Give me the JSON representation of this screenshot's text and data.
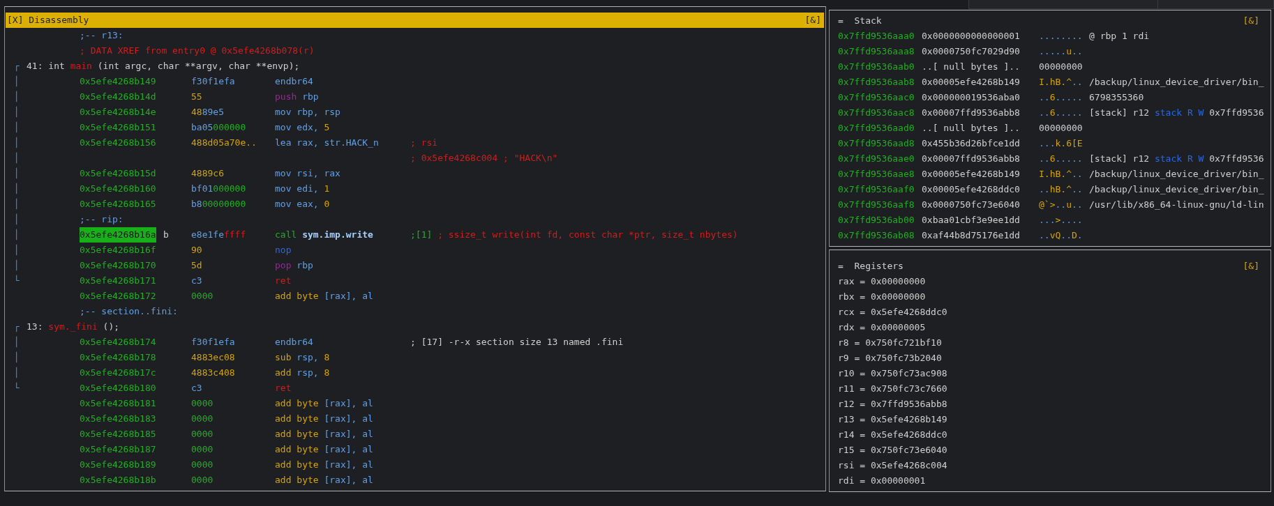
{
  "disassembly": {
    "title": "[X] Disassembly",
    "badge": "[&]",
    "lines": [
      {
        "kind": "label",
        "text": ";-- r13:"
      },
      {
        "kind": "xref",
        "text": "; DATA XREF from entry0 @ 0x5efe4268b078(r)"
      },
      {
        "kind": "func",
        "tree": "┌",
        "segments": [
          {
            "kind": "plain",
            "text": "41: int "
          },
          {
            "kind": "red",
            "text": "main"
          },
          {
            "kind": "plain",
            "text": " (int argc, char **argv, char **envp);"
          }
        ]
      },
      {
        "kind": "instr",
        "tree": "│",
        "address": "0x5efe4268b149",
        "current": false,
        "bytes": [
          {
            "kind": "hex",
            "text": "f30f1efa"
          }
        ],
        "instr": [
          {
            "kind": "op",
            "text": "endbr64"
          }
        ]
      },
      {
        "kind": "instr",
        "tree": "│",
        "address": "0x5efe4268b14d",
        "current": false,
        "bytes": [
          {
            "kind": "num",
            "text": "55"
          }
        ],
        "instr": [
          {
            "kind": "push",
            "text": "push"
          },
          {
            "kind": "op",
            "text": " rbp"
          }
        ]
      },
      {
        "kind": "instr",
        "tree": "│",
        "address": "0x5efe4268b14e",
        "current": false,
        "bytes": [
          {
            "kind": "num",
            "text": "48"
          },
          {
            "kind": "hex",
            "text": "89e5"
          }
        ],
        "instr": [
          {
            "kind": "op",
            "text": "mov rbp, rsp"
          }
        ]
      },
      {
        "kind": "instr",
        "tree": "│",
        "address": "0x5efe4268b151",
        "current": false,
        "bytes": [
          {
            "kind": "hex",
            "text": "ba05"
          },
          {
            "kind": "zero",
            "text": "000000"
          }
        ],
        "instr": [
          {
            "kind": "op",
            "text": "mov edx, "
          },
          {
            "kind": "num",
            "text": "5"
          }
        ]
      },
      {
        "kind": "instr",
        "tree": "│",
        "address": "0x5efe4268b156",
        "current": false,
        "bytes": [
          {
            "kind": "num",
            "text": "488d05a70e.."
          }
        ],
        "instr": [
          {
            "kind": "op",
            "text": "lea rax, str.HACK_n"
          }
        ],
        "comment": [
          {
            "kind": "red",
            "text": "; rsi"
          }
        ]
      },
      {
        "kind": "comment",
        "tree": "│",
        "comment": [
          {
            "kind": "red",
            "text": "; 0x5efe4268c004 ; \"HACK\\n\""
          }
        ]
      },
      {
        "kind": "instr",
        "tree": "│",
        "address": "0x5efe4268b15d",
        "current": false,
        "bytes": [
          {
            "kind": "num",
            "text": "4889c6"
          }
        ],
        "instr": [
          {
            "kind": "op",
            "text": "mov rsi, rax"
          }
        ]
      },
      {
        "kind": "instr",
        "tree": "│",
        "address": "0x5efe4268b160",
        "current": false,
        "bytes": [
          {
            "kind": "hex",
            "text": "bf01"
          },
          {
            "kind": "zero",
            "text": "000000"
          }
        ],
        "instr": [
          {
            "kind": "op",
            "text": "mov edi, "
          },
          {
            "kind": "num",
            "text": "1"
          }
        ]
      },
      {
        "kind": "instr",
        "tree": "│",
        "address": "0x5efe4268b165",
        "current": false,
        "bytes": [
          {
            "kind": "hex",
            "text": "b8"
          },
          {
            "kind": "zero",
            "text": "00000000"
          }
        ],
        "instr": [
          {
            "kind": "op",
            "text": "mov eax, "
          },
          {
            "kind": "num",
            "text": "0"
          }
        ]
      },
      {
        "kind": "label",
        "tree": "│",
        "text": ";-- rip:"
      },
      {
        "kind": "instr",
        "tree": "│",
        "address": "0x5efe4268b16a",
        "current": true,
        "flag": "b",
        "bytes": [
          {
            "kind": "hex",
            "text": "e8e1fe"
          },
          {
            "kind": "ff",
            "text": "ffff"
          }
        ],
        "instr": [
          {
            "kind": "call",
            "text": "call "
          },
          {
            "kind": "sym",
            "text": "sym.imp.write"
          }
        ],
        "comment": [
          {
            "kind": "green",
            "text": ";[1]"
          },
          {
            "kind": "red",
            "text": " ; ssize_t write(int fd, const char *ptr, size_t nbytes)"
          }
        ]
      },
      {
        "kind": "instr",
        "tree": "│",
        "address": "0x5efe4268b16f",
        "current": false,
        "bytes": [
          {
            "kind": "num",
            "text": "90"
          }
        ],
        "instr": [
          {
            "kind": "bright",
            "text": "nop"
          }
        ]
      },
      {
        "kind": "instr",
        "tree": "│",
        "address": "0x5efe4268b170",
        "current": false,
        "bytes": [
          {
            "kind": "num",
            "text": "5d"
          }
        ],
        "instr": [
          {
            "kind": "push",
            "text": "pop"
          },
          {
            "kind": "op",
            "text": " rbp"
          }
        ]
      },
      {
        "kind": "instr",
        "tree": "└",
        "address": "0x5efe4268b171",
        "current": false,
        "bytes": [
          {
            "kind": "hex",
            "text": "c3"
          }
        ],
        "instr": [
          {
            "kind": "red",
            "text": "ret"
          }
        ]
      },
      {
        "kind": "instr",
        "address": "0x5efe4268b172",
        "current": false,
        "bytes": [
          {
            "kind": "zero",
            "text": "0000"
          }
        ],
        "instr": [
          {
            "kind": "num",
            "text": "add byte "
          },
          {
            "kind": "op",
            "text": "[rax], al"
          }
        ]
      },
      {
        "kind": "label",
        "text": ";-- section..fini:"
      },
      {
        "kind": "func",
        "tree": "┌",
        "segments": [
          {
            "kind": "plain",
            "text": "13: "
          },
          {
            "kind": "red",
            "text": "sym._fini"
          },
          {
            "kind": "plain",
            "text": " ();"
          }
        ]
      },
      {
        "kind": "instr",
        "tree": "│",
        "address": "0x5efe4268b174",
        "current": false,
        "bytes": [
          {
            "kind": "hex",
            "text": "f30f1efa"
          }
        ],
        "instr": [
          {
            "kind": "op",
            "text": "endbr64"
          }
        ],
        "comment": [
          {
            "kind": "plain",
            "text": "; [17] -r-x section size 13 named .fini"
          }
        ]
      },
      {
        "kind": "instr",
        "tree": "│",
        "address": "0x5efe4268b178",
        "current": false,
        "bytes": [
          {
            "kind": "num",
            "text": "4883ec08"
          }
        ],
        "instr": [
          {
            "kind": "num",
            "text": "sub "
          },
          {
            "kind": "op",
            "text": "rsp, "
          },
          {
            "kind": "num",
            "text": "8"
          }
        ]
      },
      {
        "kind": "instr",
        "tree": "│",
        "address": "0x5efe4268b17c",
        "current": false,
        "bytes": [
          {
            "kind": "num",
            "text": "4883c408"
          }
        ],
        "instr": [
          {
            "kind": "num",
            "text": "add "
          },
          {
            "kind": "op",
            "text": "rsp, "
          },
          {
            "kind": "num",
            "text": "8"
          }
        ]
      },
      {
        "kind": "instr",
        "tree": "└",
        "address": "0x5efe4268b180",
        "current": false,
        "bytes": [
          {
            "kind": "hex",
            "text": "c3"
          }
        ],
        "instr": [
          {
            "kind": "red",
            "text": "ret"
          }
        ]
      },
      {
        "kind": "instr",
        "address": "0x5efe4268b181",
        "current": false,
        "bytes": [
          {
            "kind": "zero",
            "text": "0000"
          }
        ],
        "instr": [
          {
            "kind": "num",
            "text": "add byte "
          },
          {
            "kind": "op",
            "text": "[rax], al"
          }
        ]
      },
      {
        "kind": "instr",
        "address": "0x5efe4268b183",
        "current": false,
        "bytes": [
          {
            "kind": "zero",
            "text": "0000"
          }
        ],
        "instr": [
          {
            "kind": "num",
            "text": "add byte "
          },
          {
            "kind": "op",
            "text": "[rax], al"
          }
        ]
      },
      {
        "kind": "instr",
        "address": "0x5efe4268b185",
        "current": false,
        "bytes": [
          {
            "kind": "zero",
            "text": "0000"
          }
        ],
        "instr": [
          {
            "kind": "num",
            "text": "add byte "
          },
          {
            "kind": "op",
            "text": "[rax], al"
          }
        ]
      },
      {
        "kind": "instr",
        "address": "0x5efe4268b187",
        "current": false,
        "bytes": [
          {
            "kind": "zero",
            "text": "0000"
          }
        ],
        "instr": [
          {
            "kind": "num",
            "text": "add byte "
          },
          {
            "kind": "op",
            "text": "[rax], al"
          }
        ]
      },
      {
        "kind": "instr",
        "address": "0x5efe4268b189",
        "current": false,
        "bytes": [
          {
            "kind": "zero",
            "text": "0000"
          }
        ],
        "instr": [
          {
            "kind": "num",
            "text": "add byte "
          },
          {
            "kind": "op",
            "text": "[rax], al"
          }
        ]
      },
      {
        "kind": "instr",
        "address": "0x5efe4268b18b",
        "current": false,
        "bytes": [
          {
            "kind": "zero",
            "text": "0000"
          }
        ],
        "instr": [
          {
            "kind": "num",
            "text": "add byte "
          },
          {
            "kind": "op",
            "text": "[rax], al"
          }
        ]
      }
    ]
  },
  "stack": {
    "marker": "=",
    "title": "Stack",
    "badge": "[&]",
    "rows": [
      {
        "address": "0x7ffd9536aaa0",
        "value": "0x0000000000000001",
        "ascii": [
          {
            "kind": "dot",
            "text": "........"
          }
        ],
        "ref": [
          {
            "kind": "plain",
            "text": "@ rbp 1 rdi"
          }
        ]
      },
      {
        "address": "0x7ffd9536aaa8",
        "value": "0x0000750fc7029d90",
        "ascii": [
          {
            "kind": "dot",
            "text": "....."
          },
          {
            "kind": "chr",
            "text": "u"
          },
          {
            "kind": "dot",
            "text": ".."
          }
        ]
      },
      {
        "address": "0x7ffd9536aab0",
        "value": "..[ null bytes ]..",
        "ascii": [
          {
            "kind": "plain",
            "text": "00000000"
          }
        ]
      },
      {
        "address": "0x7ffd9536aab8",
        "value": "0x00005efe4268b149",
        "ascii": [
          {
            "kind": "chr",
            "text": "I.hB.^"
          },
          {
            "kind": "dot",
            "text": ".."
          }
        ],
        "ref": [
          {
            "kind": "plain",
            "text": "/backup/linux_device_driver/bin_"
          }
        ]
      },
      {
        "address": "0x7ffd9536aac0",
        "value": "0x000000019536aba0",
        "ascii": [
          {
            "kind": "dot",
            "text": ".."
          },
          {
            "kind": "chr",
            "text": "6"
          },
          {
            "kind": "dot",
            "text": "....."
          }
        ],
        "ref": [
          {
            "kind": "plain",
            "text": "6798355360"
          }
        ]
      },
      {
        "address": "0x7ffd9536aac8",
        "value": "0x00007ffd9536abb8",
        "ascii": [
          {
            "kind": "dot",
            "text": ".."
          },
          {
            "kind": "chr",
            "text": "6"
          },
          {
            "kind": "dot",
            "text": "....."
          }
        ],
        "ref": [
          {
            "kind": "plain",
            "text": "[stack] r12 "
          },
          {
            "kind": "bright",
            "text": "stack R W"
          },
          {
            "kind": "plain",
            "text": " 0x7ffd9536"
          }
        ]
      },
      {
        "address": "0x7ffd9536aad0",
        "value": "..[ null bytes ]..",
        "ascii": [
          {
            "kind": "plain",
            "text": "00000000"
          }
        ]
      },
      {
        "address": "0x7ffd9536aad8",
        "value": "0x455b36d26bfce1dd",
        "ascii": [
          {
            "kind": "dot",
            "text": "..."
          },
          {
            "kind": "chr",
            "text": "k.6[E"
          }
        ]
      },
      {
        "address": "0x7ffd9536aae0",
        "value": "0x00007ffd9536abb8",
        "ascii": [
          {
            "kind": "dot",
            "text": ".."
          },
          {
            "kind": "chr",
            "text": "6"
          },
          {
            "kind": "dot",
            "text": "....."
          }
        ],
        "ref": [
          {
            "kind": "plain",
            "text": "[stack] r12 "
          },
          {
            "kind": "bright",
            "text": "stack R W"
          },
          {
            "kind": "plain",
            "text": " 0x7ffd9536"
          }
        ]
      },
      {
        "address": "0x7ffd9536aae8",
        "value": "0x00005efe4268b149",
        "ascii": [
          {
            "kind": "chr",
            "text": "I.hB.^"
          },
          {
            "kind": "dot",
            "text": ".."
          }
        ],
        "ref": [
          {
            "kind": "plain",
            "text": "/backup/linux_device_driver/bin_"
          }
        ]
      },
      {
        "address": "0x7ffd9536aaf0",
        "value": "0x00005efe4268ddc0",
        "ascii": [
          {
            "kind": "dot",
            "text": ".."
          },
          {
            "kind": "chr",
            "text": "hB.^"
          },
          {
            "kind": "dot",
            "text": ".."
          }
        ],
        "ref": [
          {
            "kind": "plain",
            "text": "/backup/linux_device_driver/bin_"
          }
        ]
      },
      {
        "address": "0x7ffd9536aaf8",
        "value": "0x0000750fc73e6040",
        "ascii": [
          {
            "kind": "chr",
            "text": "@`>"
          },
          {
            "kind": "dot",
            "text": ".."
          },
          {
            "kind": "chr",
            "text": "u"
          },
          {
            "kind": "dot",
            "text": ".."
          }
        ],
        "ref": [
          {
            "kind": "plain",
            "text": "/usr/lib/x86_64-linux-gnu/ld-lin"
          }
        ]
      },
      {
        "address": "0x7ffd9536ab00",
        "value": "0xbaa01cbf3e9ee1dd",
        "ascii": [
          {
            "kind": "dot",
            "text": "..."
          },
          {
            "kind": "chr",
            "text": ">"
          },
          {
            "kind": "dot",
            "text": "...."
          }
        ]
      },
      {
        "address": "0x7ffd9536ab08",
        "value": "0xaf44b8d75176e1dd",
        "ascii": [
          {
            "kind": "dot",
            "text": ".."
          },
          {
            "kind": "chr",
            "text": "vQ"
          },
          {
            "kind": "dot",
            "text": ".."
          },
          {
            "kind": "chr",
            "text": "D"
          },
          {
            "kind": "dot",
            "text": "."
          }
        ]
      }
    ]
  },
  "registers": {
    "marker": "=",
    "title": "Registers",
    "badge": "[&]",
    "rows": [
      "rax = 0x00000000",
      "rbx = 0x00000000",
      "rcx = 0x5efe4268ddc0",
      "rdx = 0x00000005",
      "r8 = 0x750fc721bf10",
      "r9 = 0x750fc73b2040",
      "r10 = 0x750fc73ac908",
      "r11 = 0x750fc73c7660",
      "r12 = 0x7ffd9536abb8",
      "r13 = 0x5efe4268b149",
      "r14 = 0x5efe4268ddc0",
      "r15 = 0x750fc73e6040",
      "rsi = 0x5efe4268c004",
      "rdi = 0x00000001"
    ]
  }
}
